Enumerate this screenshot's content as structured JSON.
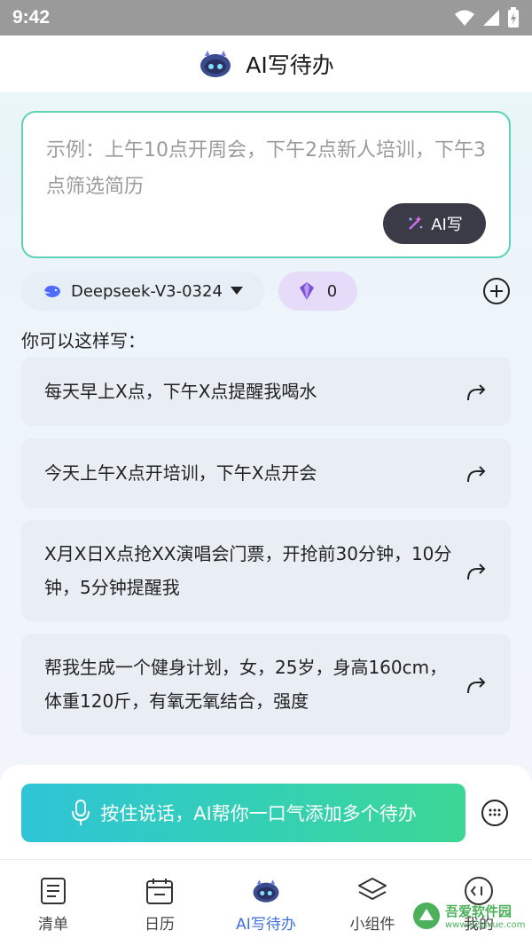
{
  "status": {
    "time": "9:42"
  },
  "header": {
    "title": "AI写待办"
  },
  "prompt": {
    "placeholder": "示例：上午10点开周会，下午2点新人培训，下午3点筛选简历",
    "ai_button_label": "AI写"
  },
  "model": {
    "name": "Deepseek-V3-0324",
    "credits": "0"
  },
  "suggestions": {
    "heading": "你可以这样写：",
    "items": [
      {
        "text": "每天早上X点，下午X点提醒我喝水"
      },
      {
        "text": "今天上午X点开培训，下午X点开会"
      },
      {
        "text": "X月X日X点抢XX演唱会门票，开抢前30分钟，10分钟，5分钟提醒我"
      },
      {
        "text": "帮我生成一个健身计划，女，25岁，身高160cm，体重120斤，有氧无氧结合，强度"
      }
    ]
  },
  "voice": {
    "label": "按住说话，AI帮你一口气添加多个待办"
  },
  "nav": {
    "items": [
      {
        "label": "清单",
        "icon": "list-icon"
      },
      {
        "label": "日历",
        "icon": "calendar-icon"
      },
      {
        "label": "AI写待办",
        "icon": "robot-icon",
        "active": true
      },
      {
        "label": "小组件",
        "icon": "layers-icon"
      },
      {
        "label": "我的",
        "icon": "profile-icon"
      }
    ]
  },
  "watermark": {
    "name": "吾爱软件园",
    "url": "www.52zixue.com"
  },
  "colors": {
    "accent": "#3c6ee0",
    "border": "#5ed2b6",
    "voice_start": "#2fc4d7",
    "voice_end": "#3cd795"
  }
}
